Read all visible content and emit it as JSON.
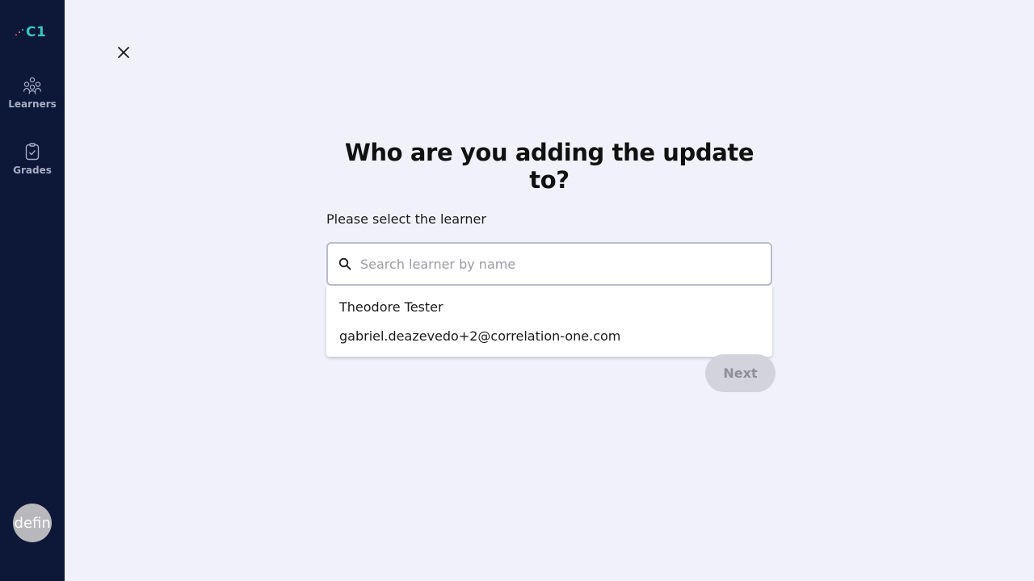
{
  "sidebar": {
    "logo": {
      "text": "C1",
      "text_color": "#3cc6c0",
      "dot_colors": [
        "#e8673c",
        "#f0a03c",
        "#3cc6c0"
      ]
    },
    "items": [
      {
        "label": "Learners",
        "icon": "people-network-icon"
      },
      {
        "label": "Grades",
        "icon": "clipboard-check-icon"
      }
    ],
    "avatar_text": "undefined",
    "background": "#0d1838"
  },
  "close": {
    "icon": "close-icon"
  },
  "main": {
    "title": "Who are you adding the update to?",
    "field_label": "Please select the learner",
    "search": {
      "placeholder": "Search learner by name",
      "value": "",
      "icon": "search-icon"
    },
    "options": [
      {
        "label": "Theodore Tester"
      },
      {
        "label": "gabriel.deazevedo+2@correlation-one.com"
      }
    ],
    "next_label": "Next"
  }
}
